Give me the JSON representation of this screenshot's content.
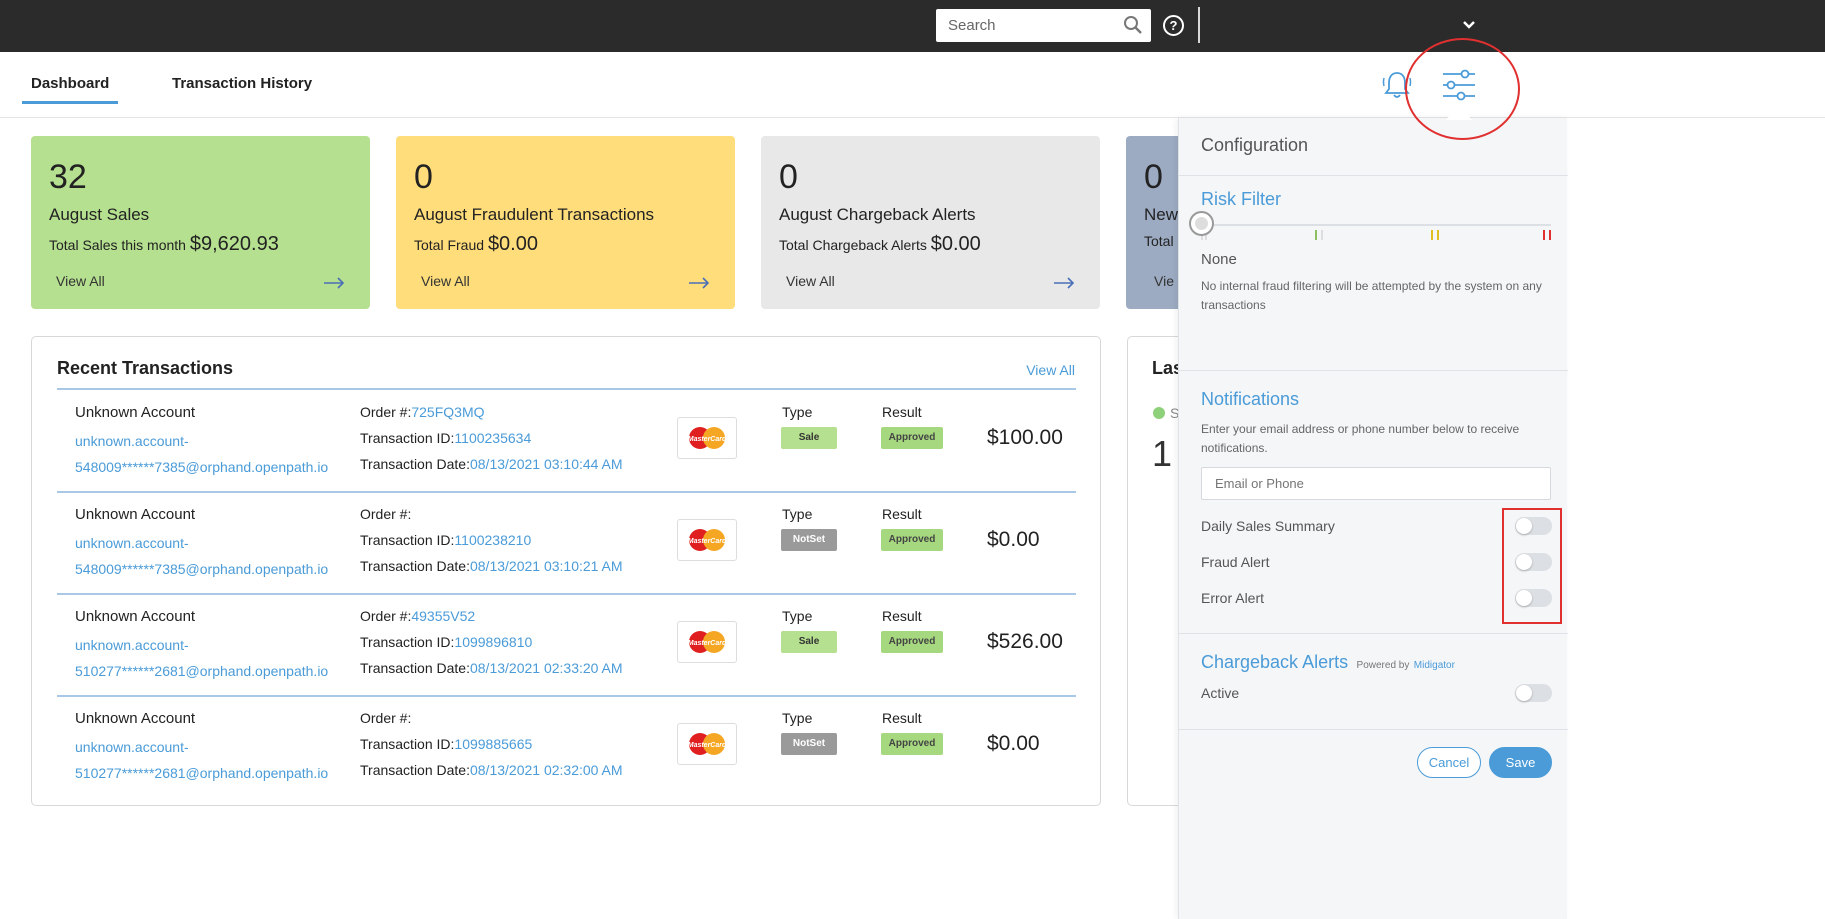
{
  "topbar": {
    "search_placeholder": "Search",
    "help_label": "?"
  },
  "nav": {
    "tabs": [
      "Dashboard",
      "Transaction History"
    ]
  },
  "cards": [
    {
      "num": "32",
      "title": "August Sales",
      "sub_label": "Total Sales this month",
      "sub_value": "$9,620.93",
      "view": "View All",
      "color": "#b5e08f"
    },
    {
      "num": "0",
      "title": "August Fraudulent Transactions",
      "sub_label": "Total Fraud",
      "sub_value": "$0.00",
      "view": "View All",
      "color": "#ffdd7a"
    },
    {
      "num": "0",
      "title": "August Chargeback Alerts",
      "sub_label": "Total Chargeback Alerts",
      "sub_value": "$0.00",
      "view": "View All",
      "color": "#e8e8e8"
    },
    {
      "num": "0",
      "title": "New",
      "sub_label": "Total N",
      "sub_value": "",
      "view": "Vie",
      "color": "#9cabc2"
    }
  ],
  "recent": {
    "title": "Recent Transactions",
    "view_all": "View All",
    "labels": {
      "order": "Order #:",
      "txid": "Transaction ID:",
      "txdate": "Transaction Date:",
      "type": "Type",
      "result": "Result"
    },
    "card_brand": "MasterCard",
    "rows": [
      {
        "account": "Unknown Account",
        "email1": "unknown.account-",
        "email2": "548009******7385@orphand.openpath.io",
        "order": "725FQ3MQ",
        "txid": "1100235634",
        "date": "08/13/2021 03:10:44 AM",
        "type": "Sale",
        "result": "Approved",
        "amount": "$100.00"
      },
      {
        "account": "Unknown Account",
        "email1": "unknown.account-",
        "email2": "548009******7385@orphand.openpath.io",
        "order": "",
        "txid": "1100238210",
        "date": "08/13/2021 03:10:21 AM",
        "type": "NotSet",
        "result": "Approved",
        "amount": "$0.00"
      },
      {
        "account": "Unknown Account",
        "email1": "unknown.account-",
        "email2": "510277******2681@orphand.openpath.io",
        "order": "49355V52",
        "txid": "1099896810",
        "date": "08/13/2021 02:33:20 AM",
        "type": "Sale",
        "result": "Approved",
        "amount": "$526.00"
      },
      {
        "account": "Unknown Account",
        "email1": "unknown.account-",
        "email2": "510277******2681@orphand.openpath.io",
        "order": "",
        "txid": "1099885665",
        "date": "08/13/2021 02:32:00 AM",
        "type": "NotSet",
        "result": "Approved",
        "amount": "$0.00"
      }
    ]
  },
  "peek": {
    "title": "Las",
    "status": "S",
    "num": "1"
  },
  "config": {
    "title": "Configuration",
    "risk": {
      "title": "Risk Filter",
      "level": "None",
      "desc": "No internal fraud filtering will be attempted by the system on any transactions"
    },
    "notifications": {
      "title": "Notifications",
      "desc": "Enter your email address or phone number below to receive notifications.",
      "input_placeholder": "Email or Phone",
      "toggles": [
        "Daily Sales Summary",
        "Fraud Alert",
        "Error Alert"
      ]
    },
    "chargeback": {
      "title": "Chargeback Alerts",
      "powered": "Powered by",
      "provider": "Midigator",
      "active": "Active"
    },
    "cancel": "Cancel",
    "save": "Save"
  },
  "colors": {
    "accent": "#4a9bd8",
    "annotation": "#e03030",
    "sale_badge": "#b5e08f",
    "notset_badge": "#9a9a9a",
    "approved_badge": "#a6d87f"
  }
}
